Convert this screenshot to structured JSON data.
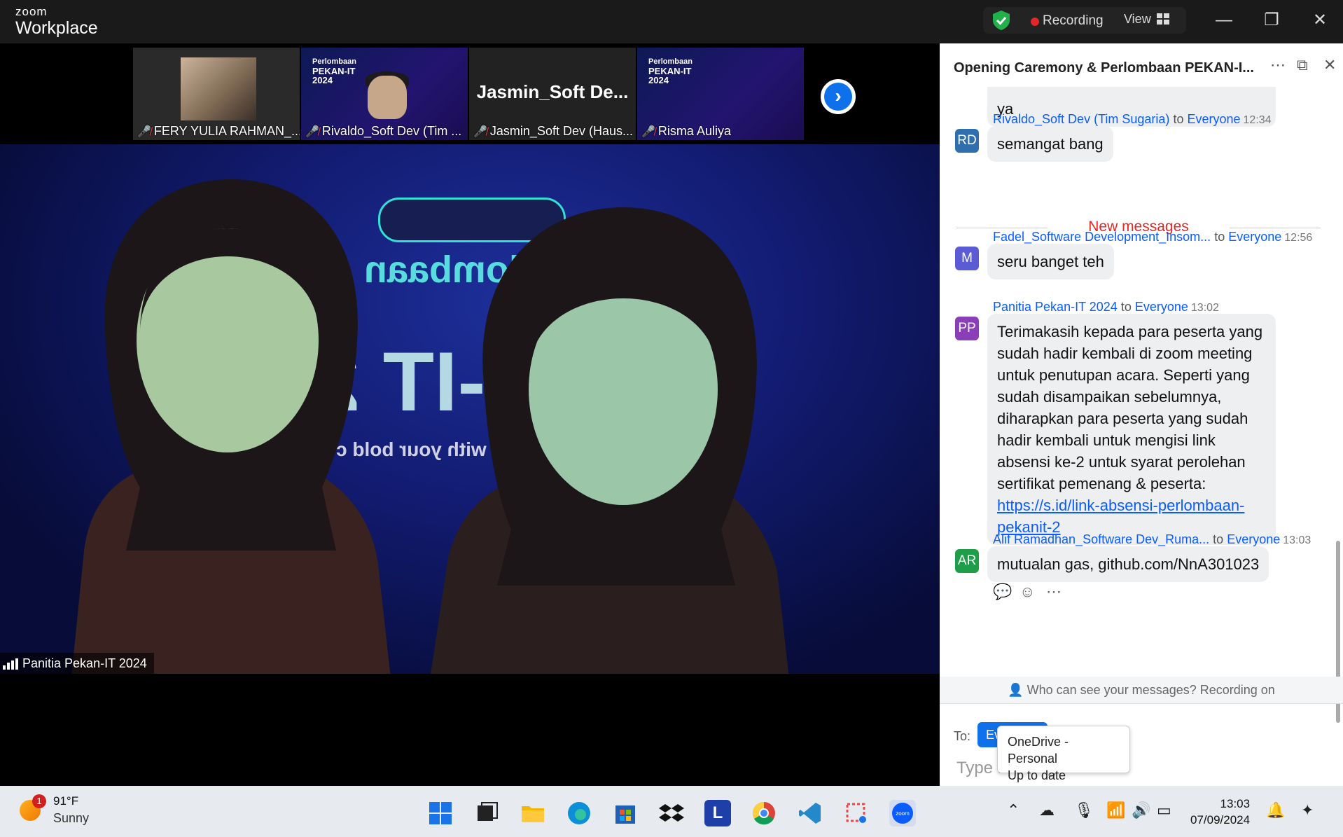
{
  "app": {
    "brand_small": "zoom",
    "brand_name": "Workplace"
  },
  "titlebar": {
    "recording_label": "Recording",
    "view_label": "View",
    "minimize": "—",
    "restore": "❐",
    "close": "✕"
  },
  "thumbnails": [
    {
      "name": "FERY YULIA RAHMAN_..."
    },
    {
      "name": "Rivaldo_Soft Dev (Tim ...",
      "slide_small": "Perlombaan",
      "slide_title": "PEKAN-IT",
      "slide_year": "2024"
    },
    {
      "name": "Jasmin_Soft Dev (Haus...",
      "big_name": "Jasmin_Soft De..."
    },
    {
      "name": "Risma Auliya",
      "slide_small": "Perlombaan",
      "slide_title": "PEKAN-IT",
      "slide_year": "2024"
    }
  ],
  "speaker": {
    "label": "Panitia Pekan-IT 2024",
    "banner_line1": "Perlombaan",
    "banner_line2": "AN-IT 20",
    "banner_line3": "ation with your bold c"
  },
  "chat": {
    "title": "Opening Caremony & Perlombaan PEKAN-I...",
    "more_icon": "⋯",
    "popout_icon": "⧉",
    "close_icon": "✕",
    "prev_tail": "ya",
    "new_messages": "New messages",
    "messages": [
      {
        "initials": "RD",
        "color": "#2f6fad",
        "sender": "Rivaldo_Soft Dev (Tim Sugaria)",
        "to": "to",
        "recipient": "Everyone",
        "time": "12:34",
        "text": "semangat bang"
      },
      {
        "initials": "M",
        "color": "#5b5bd6",
        "sender": "Fadel_Software Development_Insom...",
        "to": "to",
        "recipient": "Everyone",
        "time": "12:56",
        "text": "seru banget teh"
      },
      {
        "initials": "PP",
        "color": "#8a3fb8",
        "sender": "Panitia Pekan-IT 2024",
        "to": "to",
        "recipient": "Everyone",
        "time": "13:02",
        "text": "Terimakasih kepada para peserta yang sudah hadir kembali di zoom meeting untuk penutupan acara. Seperti yang sudah disampaikan sebelumnya, diharapkan para peserta yang sudah hadir kembali untuk mengisi link absensi ke-2 untuk syarat perolehan sertifikat pemenang & peserta:",
        "link": "https://s.id/link-absensi-perlombaan-pekanit-2"
      },
      {
        "initials": "AR",
        "color": "#1f9e4a",
        "sender": "Alif Ramadhan_Software Dev_Ruma...",
        "to": "to",
        "recipient": "Everyone",
        "time": "13:03",
        "text": "mutualan gas, github.com/NnA301023"
      }
    ],
    "privacy_note": "Who can see your messages? Recording on",
    "to_label": "To:",
    "to_value": "Everyone",
    "input_placeholder": "Type message here..."
  },
  "tooltip": {
    "line1": "OneDrive - Personal",
    "line2": "Up to date"
  },
  "taskbar": {
    "weather_badge": "1",
    "temperature": "91°F",
    "condition": "Sunny",
    "l_app": "L",
    "time": "13:03",
    "date": "07/09/2024"
  }
}
